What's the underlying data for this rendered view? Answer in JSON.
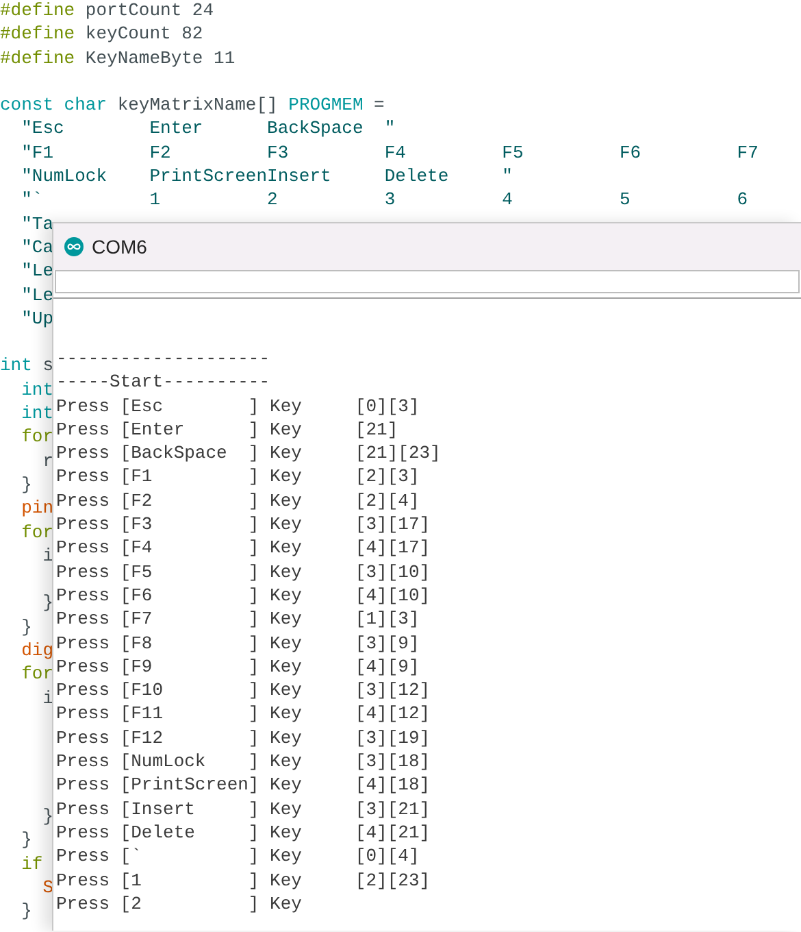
{
  "editor": {
    "lines": [
      {
        "kind": "code",
        "tokens": [
          {
            "kind": "directive",
            "text": "#define"
          },
          {
            "kind": "plain",
            "text": " portCount 24"
          }
        ]
      },
      {
        "kind": "code",
        "tokens": [
          {
            "kind": "directive",
            "text": "#define"
          },
          {
            "kind": "plain",
            "text": " keyCount 82"
          }
        ]
      },
      {
        "kind": "code",
        "tokens": [
          {
            "kind": "directive",
            "text": "#define"
          },
          {
            "kind": "plain",
            "text": " KeyNameByte 11"
          }
        ]
      },
      {
        "kind": "blank"
      },
      {
        "kind": "code",
        "tokens": [
          {
            "kind": "keyword",
            "text": "const char"
          },
          {
            "kind": "plain",
            "text": " keyMatrixName[] "
          },
          {
            "kind": "keyword",
            "text": "PROGMEM"
          },
          {
            "kind": "plain",
            "text": " ="
          }
        ]
      },
      {
        "kind": "code",
        "tokens": [
          {
            "kind": "string",
            "text": "  \"Esc        Enter      BackSpace  \""
          }
        ]
      },
      {
        "kind": "code",
        "tokens": [
          {
            "kind": "string",
            "text": "  \"F1         F2         F3         F4         F5         F6         F7"
          }
        ]
      },
      {
        "kind": "code",
        "tokens": [
          {
            "kind": "string",
            "text": "  \"NumLock    PrintScreenInsert     Delete     \""
          }
        ]
      },
      {
        "kind": "code",
        "tokens": [
          {
            "kind": "string",
            "text": "  \"`          1          2          3          4          5          6"
          }
        ]
      },
      {
        "kind": "code",
        "tokens": [
          {
            "kind": "string",
            "text": "  \"Ta"
          }
        ]
      },
      {
        "kind": "code",
        "tokens": [
          {
            "kind": "string",
            "text": "  \"Ca"
          }
        ]
      },
      {
        "kind": "code",
        "tokens": [
          {
            "kind": "string",
            "text": "  \"Le"
          }
        ]
      },
      {
        "kind": "code",
        "tokens": [
          {
            "kind": "string",
            "text": "  \"Le"
          }
        ]
      },
      {
        "kind": "code",
        "tokens": [
          {
            "kind": "string",
            "text": "  \"Up"
          }
        ]
      },
      {
        "kind": "blank"
      },
      {
        "kind": "code",
        "tokens": [
          {
            "kind": "keyword",
            "text": "int"
          },
          {
            "kind": "plain",
            "text": " s"
          }
        ]
      },
      {
        "kind": "code",
        "tokens": [
          {
            "kind": "keyword",
            "text": "  int"
          }
        ]
      },
      {
        "kind": "code",
        "tokens": [
          {
            "kind": "keyword",
            "text": "  int"
          }
        ]
      },
      {
        "kind": "code",
        "tokens": [
          {
            "kind": "control",
            "text": "  for"
          }
        ]
      },
      {
        "kind": "code",
        "tokens": [
          {
            "kind": "plain",
            "text": "    r"
          }
        ]
      },
      {
        "kind": "code",
        "tokens": [
          {
            "kind": "plain",
            "text": "  }"
          }
        ]
      },
      {
        "kind": "code",
        "tokens": [
          {
            "kind": "function",
            "text": "  pin"
          }
        ]
      },
      {
        "kind": "code",
        "tokens": [
          {
            "kind": "control",
            "text": "  for"
          }
        ]
      },
      {
        "kind": "code",
        "tokens": [
          {
            "kind": "plain",
            "text": "    i"
          }
        ]
      },
      {
        "kind": "blank"
      },
      {
        "kind": "code",
        "tokens": [
          {
            "kind": "plain",
            "text": "    }"
          }
        ]
      },
      {
        "kind": "code",
        "tokens": [
          {
            "kind": "plain",
            "text": "  }"
          }
        ]
      },
      {
        "kind": "code",
        "tokens": [
          {
            "kind": "function",
            "text": "  dig"
          }
        ]
      },
      {
        "kind": "code",
        "tokens": [
          {
            "kind": "control",
            "text": "  for"
          }
        ]
      },
      {
        "kind": "code",
        "tokens": [
          {
            "kind": "plain",
            "text": "    i"
          }
        ]
      },
      {
        "kind": "blank"
      },
      {
        "kind": "blank"
      },
      {
        "kind": "blank"
      },
      {
        "kind": "blank"
      },
      {
        "kind": "code",
        "tokens": [
          {
            "kind": "plain",
            "text": "    }"
          }
        ]
      },
      {
        "kind": "code",
        "tokens": [
          {
            "kind": "plain",
            "text": "  }"
          }
        ]
      },
      {
        "kind": "code",
        "tokens": [
          {
            "kind": "control",
            "text": "  if"
          }
        ]
      },
      {
        "kind": "code",
        "tokens": [
          {
            "kind": "function",
            "text": "    S"
          }
        ]
      },
      {
        "kind": "code",
        "tokens": [
          {
            "kind": "plain",
            "text": "  }"
          }
        ]
      }
    ]
  },
  "serial_monitor": {
    "title": "COM6",
    "output_lines": [
      "--------------------",
      "-----Start----------",
      "Press [Esc        ] Key     [0][3]",
      "Press [Enter      ] Key     [21]",
      "Press [BackSpace  ] Key     [21][23]",
      "Press [F1         ] Key     [2][3]",
      "Press [F2         ] Key     [2][4]",
      "Press [F3         ] Key     [3][17]",
      "Press [F4         ] Key     [4][17]",
      "Press [F5         ] Key     [3][10]",
      "Press [F6         ] Key     [4][10]",
      "Press [F7         ] Key     [1][3]",
      "Press [F8         ] Key     [3][9]",
      "Press [F9         ] Key     [4][9]",
      "Press [F10        ] Key     [3][12]",
      "Press [F11        ] Key     [4][12]",
      "Press [F12        ] Key     [3][19]",
      "Press [NumLock    ] Key     [3][18]",
      "Press [PrintScreen] Key     [4][18]",
      "Press [Insert     ] Key     [3][21]",
      "Press [Delete     ] Key     [4][21]",
      "Press [`          ] Key     [0][4]",
      "Press [1          ] Key     [2][23]",
      "Press [2          ] Key"
    ]
  }
}
